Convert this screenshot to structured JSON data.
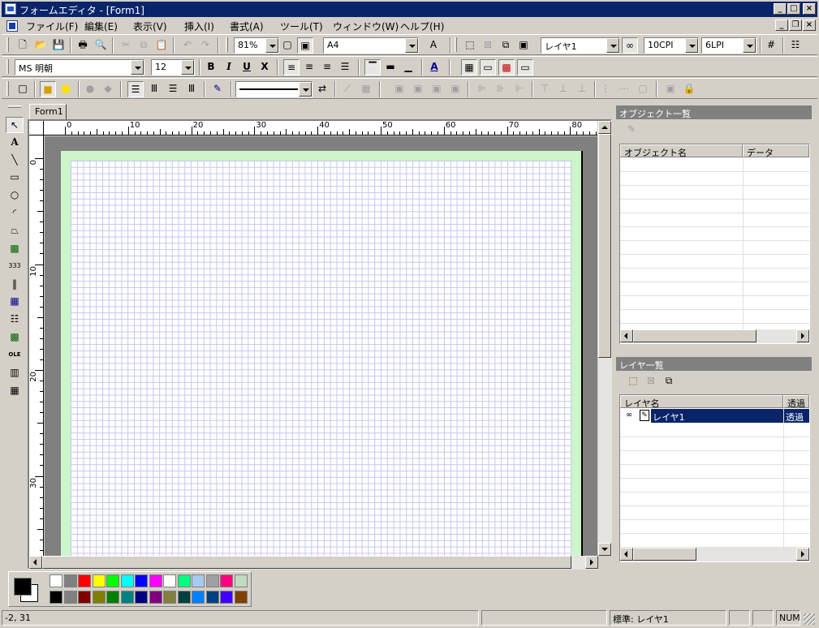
{
  "window": {
    "title": "フォームエディタ - [Form1]"
  },
  "menu": [
    "ファイル(F)",
    "編集(E)",
    "表示(V)",
    "挿入(I)",
    "書式(A)",
    "ツール(T)",
    "ウィンドウ(W)",
    "ヘルプ(H)"
  ],
  "toolbar1": {
    "zoom": "81%",
    "paper_size": "A4",
    "layer": "レイヤ1",
    "cpi": "10CPI",
    "lpi": "6LPI"
  },
  "toolbar2": {
    "font_name": "MS 明朝",
    "font_size": "12",
    "bold": "B",
    "italic": "I",
    "underline": "U",
    "strike": "X"
  },
  "document_tab": "Form1",
  "ruler": {
    "h_ticks": [
      "0",
      "10",
      "20",
      "30",
      "40",
      "50",
      "60",
      "70",
      "80"
    ],
    "v_ticks": [
      "0",
      "10",
      "20",
      "30"
    ]
  },
  "object_panel": {
    "title": "オブジェクト一覧",
    "columns": [
      "オブジェクト名",
      "データ"
    ]
  },
  "layer_panel": {
    "title": "レイヤ一覧",
    "columns": [
      "レイヤ名",
      "透過"
    ],
    "rows": [
      {
        "name": "レイヤ1",
        "transparent": "透過"
      }
    ]
  },
  "palette": {
    "foreground": "#000000",
    "background": "#ffffff",
    "row1": [
      "#ffffff",
      "#808080",
      "#ff0000",
      "#ffff00",
      "#00ff00",
      "#00ffff",
      "#0000ff",
      "#ff00ff",
      "#ffffff",
      "#00ff80",
      "#a6caf0",
      "#a0a0a4",
      "#ff0080",
      "#c0dcc0"
    ],
    "row2": [
      "#000000",
      "#808080",
      "#800000",
      "#808000",
      "#008000",
      "#008080",
      "#000080",
      "#800080",
      "#808040",
      "#004040",
      "#0080ff",
      "#004080",
      "#4000ff",
      "#804000"
    ]
  },
  "status": {
    "coords": "-2, 31",
    "layer_status": "標準: レイヤ1",
    "num": "NUM"
  }
}
